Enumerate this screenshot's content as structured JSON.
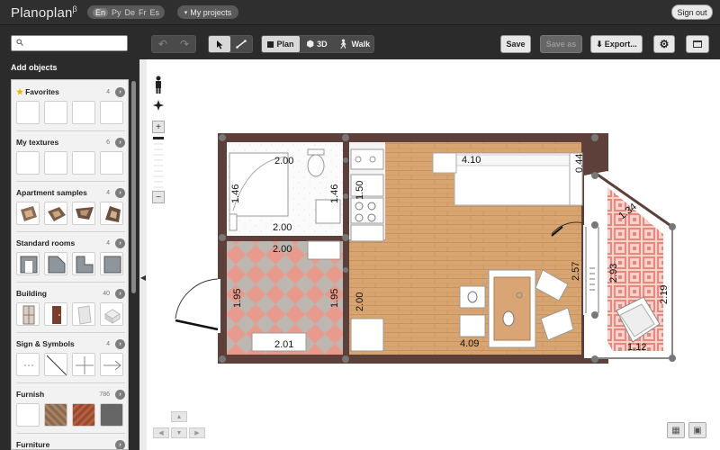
{
  "app": {
    "logo": "Planoplan",
    "logo_sup": "β",
    "languages": [
      "En",
      "Ру",
      "De",
      "Fr",
      "Es"
    ],
    "active_language": "En",
    "my_projects": "My projects",
    "sign_out": "Sign out"
  },
  "toolbar": {
    "search_placeholder": "",
    "undo_icon": "undo-icon",
    "redo_icon": "redo-icon",
    "select_icon": "cursor-icon",
    "wall_icon": "wall-tool-icon",
    "plan_label": "Plan",
    "view3d_label": "3D",
    "walk_label": "Walk",
    "save_label": "Save",
    "save_as_label": "Save as",
    "export_label": "Export...",
    "settings_icon": "gear-icon",
    "window_icon": "window-icon"
  },
  "sidebar": {
    "title": "Add objects",
    "categories": [
      {
        "label": "Favorites",
        "count": "4"
      },
      {
        "label": "My textures",
        "count": "6"
      },
      {
        "label": "Apartment samples",
        "count": "4"
      },
      {
        "label": "Standard rooms",
        "count": "4"
      },
      {
        "label": "Building",
        "count": "40"
      },
      {
        "label": "Sign & Symbols",
        "count": "4"
      },
      {
        "label": "Furnish",
        "count": "786"
      },
      {
        "label": "Furniture",
        "count": ""
      }
    ]
  },
  "plan": {
    "dimensions": [
      "2.00",
      "1.46",
      "1.46",
      "2.00",
      "2.00",
      "1.95",
      "1.95",
      "2.01",
      "2.00",
      "1.50",
      "4.10",
      "0.44",
      "2.57",
      "2.93",
      "1.34",
      "2.19",
      "4.09",
      "1.12"
    ]
  },
  "colors": {
    "topbar": "#2f2f2f",
    "wall": "#5c4039",
    "wood": "#d9a774",
    "tile_pink": "#e89a8c",
    "tile_gray": "#bdb7b2"
  }
}
